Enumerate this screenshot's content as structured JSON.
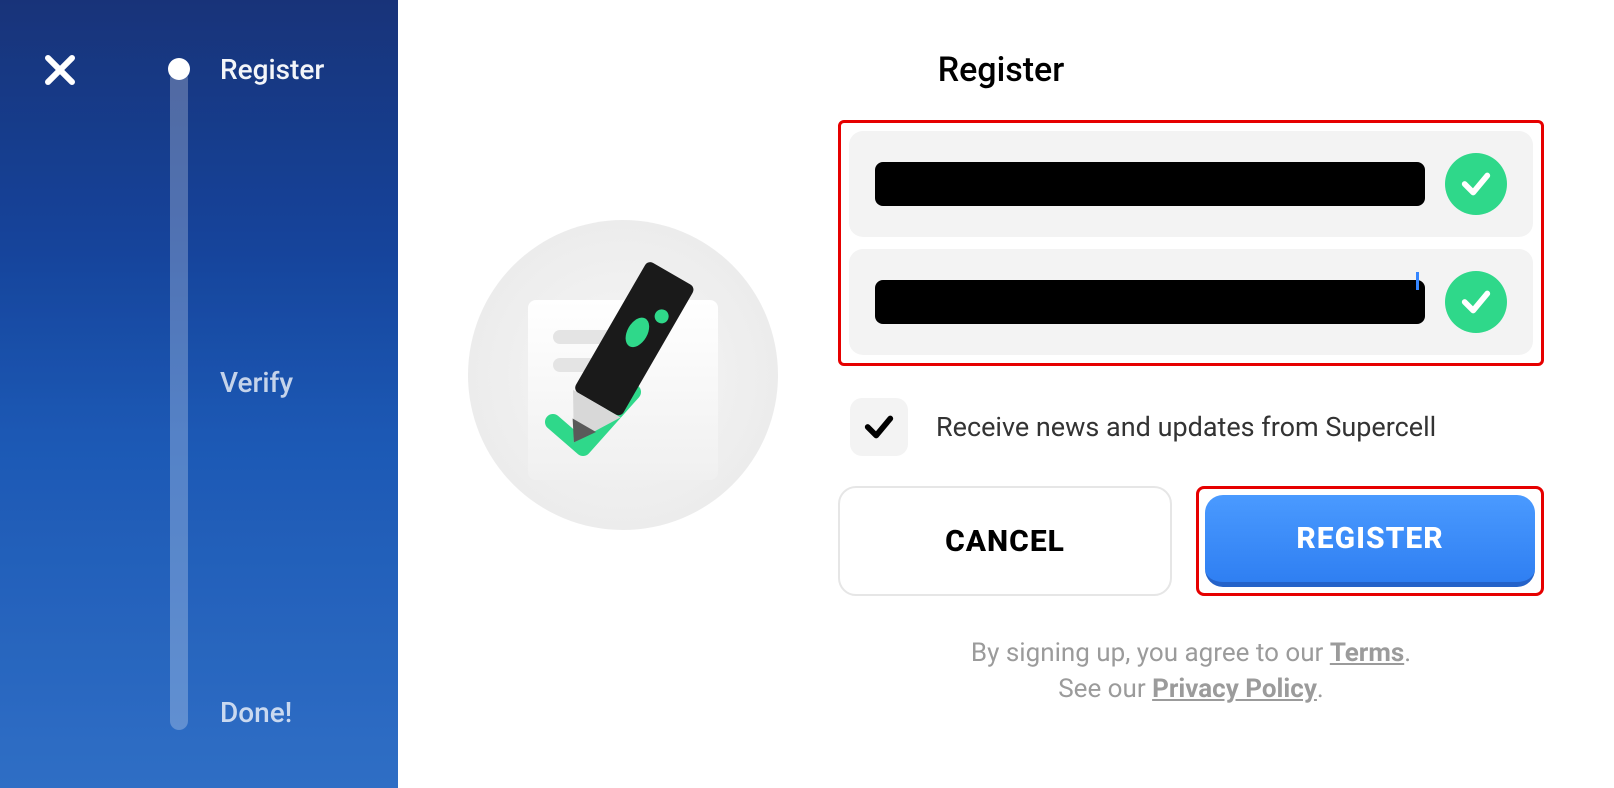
{
  "sidebar": {
    "steps": [
      {
        "label": "Register",
        "active": true
      },
      {
        "label": "Verify",
        "active": false
      },
      {
        "label": "Done!",
        "active": false
      }
    ]
  },
  "main": {
    "title": "Register",
    "inputs": {
      "field1_value": "",
      "field2_value": ""
    },
    "checkbox_label": "Receive news and updates from Supercell",
    "checkbox_checked": true,
    "buttons": {
      "cancel": "CANCEL",
      "register": "REGISTER"
    },
    "footer": {
      "line1_prefix": "By signing up, you agree to our ",
      "terms": "Terms",
      "line1_suffix": ".",
      "line2_prefix": "See our ",
      "privacy": "Privacy Policy",
      "line2_suffix": "."
    }
  },
  "colors": {
    "accent_green": "#2fd88a",
    "accent_blue": "#3586ff",
    "highlight_red": "#e60000"
  }
}
